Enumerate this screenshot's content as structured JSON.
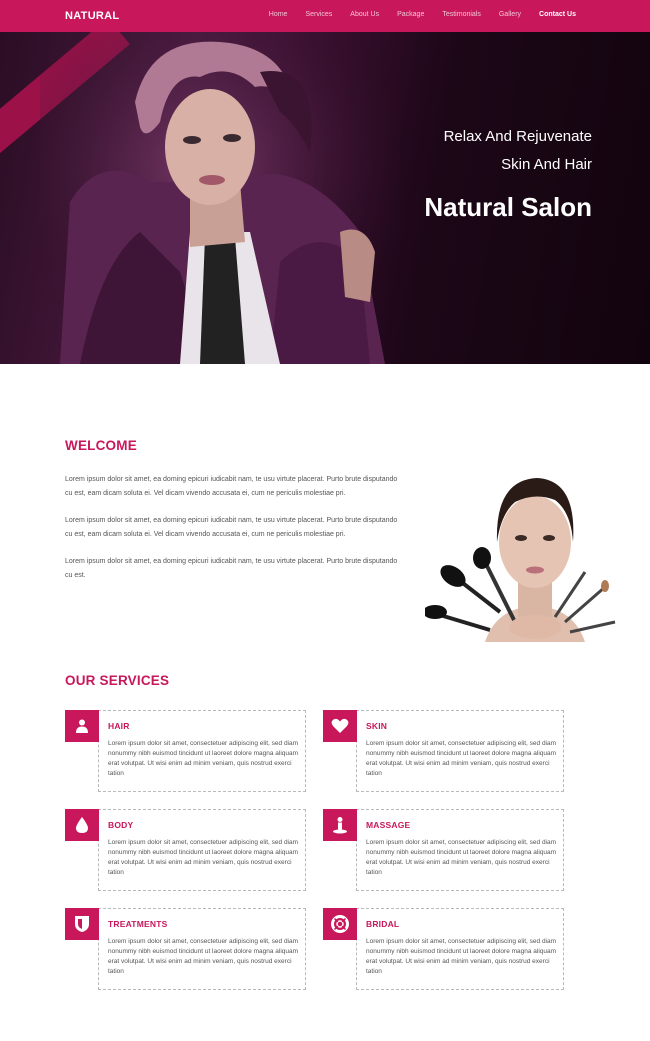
{
  "nav": {
    "brand": "NATURAL",
    "items": [
      "Home",
      "Services",
      "About Us",
      "Package",
      "Testimonials",
      "Gallery",
      "Contact Us"
    ],
    "active": "Contact Us"
  },
  "hero": {
    "line1": "Relax And Rejuvenate",
    "line2": "Skin And Hair",
    "title": "Natural Salon"
  },
  "welcome": {
    "title": "WELCOME",
    "paragraphs": [
      "Lorem ipsum dolor sit amet, ea doming epicuri iudicabit nam, te usu virtute placerat. Purto brute disputando cu est, eam dicam soluta ei. Vel dicam vivendo accusata ei, cum ne periculis molestiae pri.",
      "Lorem ipsum dolor sit amet, ea doming epicuri iudicabit nam, te usu virtute placerat. Purto brute disputando cu est, eam dicam soluta ei. Vel dicam vivendo accusata ei, cum ne periculis molestiae pri.",
      "Lorem ipsum dolor sit amet, ea doming epicuri iudicabit nam, te usu virtute placerat. Purto brute disputando cu est."
    ]
  },
  "services": {
    "title": "OUR SERVICES",
    "items": [
      {
        "title": "HAIR",
        "icon": "person-icon",
        "desc": "Lorem ipsum dolor sit amet, consectetuer adipiscing elit, sed diam nonummy nibh euismod tincidunt ut laoreet dolore magna aliquam erat volutpat. Ut wisi enim ad minim veniam, quis nostrud exerci tation"
      },
      {
        "title": "SKIN",
        "icon": "heart-icon",
        "desc": "Lorem ipsum dolor sit amet, consectetuer adipiscing elit, sed diam nonummy nibh euismod tincidunt ut laoreet dolore magna aliquam erat volutpat. Ut wisi enim ad minim veniam, quis nostrud exerci tation"
      },
      {
        "title": "BODY",
        "icon": "drop-icon",
        "desc": "Lorem ipsum dolor sit amet, consectetuer adipiscing elit, sed diam nonummy nibh euismod tincidunt ut laoreet dolore magna aliquam erat volutpat. Ut wisi enim ad minim veniam, quis nostrud exerci tation"
      },
      {
        "title": "MASSAGE",
        "icon": "massage-icon",
        "desc": "Lorem ipsum dolor sit amet, consectetuer adipiscing elit, sed diam nonummy nibh euismod tincidunt ut laoreet dolore magna aliquam erat volutpat. Ut wisi enim ad minim veniam, quis nostrud exerci tation"
      },
      {
        "title": "TREATMENTS",
        "icon": "shield-icon",
        "desc": "Lorem ipsum dolor sit amet, consectetuer adipiscing elit, sed diam nonummy nibh euismod tincidunt ut laoreet dolore magna aliquam erat volutpat. Ut wisi enim ad minim veniam, quis nostrud exerci tation"
      },
      {
        "title": "BRIDAL",
        "icon": "lifebuoy-icon",
        "desc": "Lorem ipsum dolor sit amet, consectetuer adipiscing elit, sed diam nonummy nibh euismod tincidunt ut laoreet dolore magna aliquam erat volutpat. Ut wisi enim ad minim veniam, quis nostrud exerci tation"
      }
    ]
  },
  "colors": {
    "accent": "#c8175a",
    "hero_dark": "#1c0717",
    "text": "#555555"
  }
}
